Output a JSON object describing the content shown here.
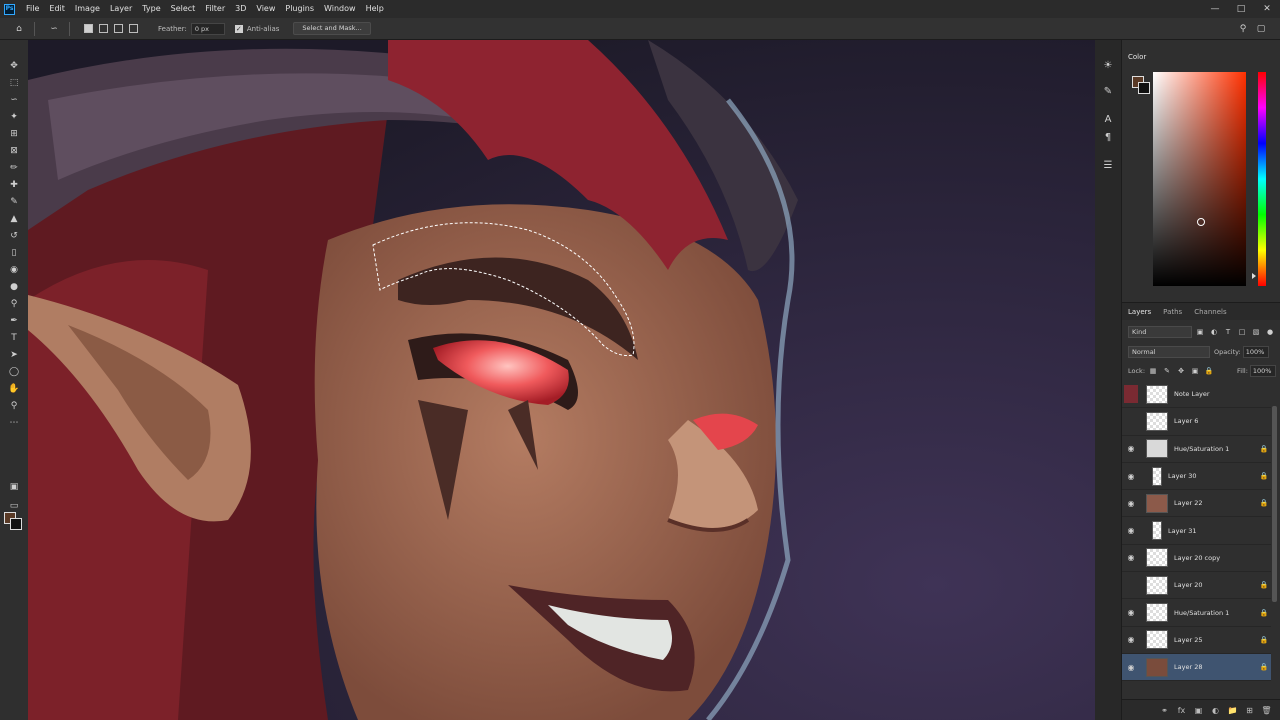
{
  "menubar": {
    "items": [
      "File",
      "Edit",
      "Image",
      "Layer",
      "Type",
      "Select",
      "Filter",
      "3D",
      "View",
      "Plugins",
      "Window",
      "Help"
    ]
  },
  "options": {
    "feather_label": "Feather:",
    "feather_value": "0 px",
    "antialias_label": "Anti-alias",
    "select_mask_label": "Select and Mask..."
  },
  "color_panel": {
    "title": "Color",
    "foreground": "#5a3a26",
    "background": "#111111"
  },
  "layers_panel": {
    "tabs": [
      "Layers",
      "Paths",
      "Channels"
    ],
    "kind_label": "Kind",
    "blend_mode": "Normal",
    "opacity_label": "Opacity:",
    "opacity_value": "100%",
    "lock_label": "Lock:",
    "fill_label": "Fill:",
    "fill_value": "100%",
    "layers": [
      {
        "name": "Note Layer",
        "visible": false,
        "locked": false
      },
      {
        "name": "Layer 6",
        "visible": false,
        "locked": false
      },
      {
        "name": "Hue/Saturation 1",
        "visible": true,
        "locked": true
      },
      {
        "name": "Layer 30",
        "visible": true,
        "locked": true
      },
      {
        "name": "Layer 22",
        "visible": true,
        "locked": true
      },
      {
        "name": "Layer 31",
        "visible": true,
        "locked": false
      },
      {
        "name": "Layer 20 copy",
        "visible": true,
        "locked": false
      },
      {
        "name": "Layer 20",
        "visible": false,
        "locked": true
      },
      {
        "name": "Hue/Saturation 1",
        "visible": true,
        "locked": true
      },
      {
        "name": "Layer 25",
        "visible": true,
        "locked": true
      },
      {
        "name": "Layer 28",
        "visible": true,
        "locked": true,
        "selected": true
      }
    ]
  }
}
